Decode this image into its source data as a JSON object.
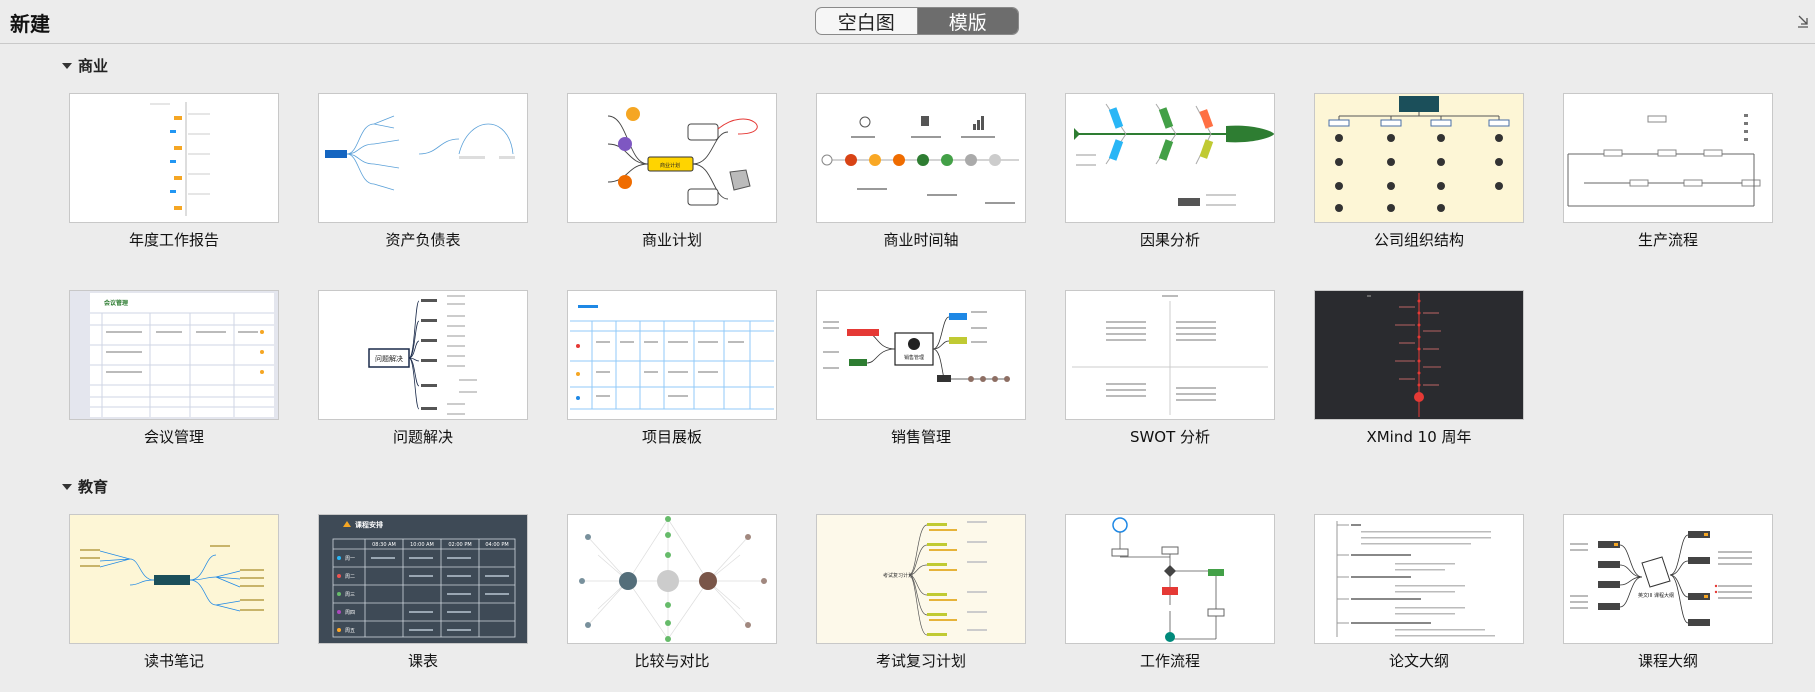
{
  "header": {
    "title": "新建",
    "tabs": [
      {
        "label": "空白图",
        "active": false
      },
      {
        "label": "模版",
        "active": true
      }
    ],
    "corner_icon": "expand-icon"
  },
  "sections": [
    {
      "title": "商业",
      "templates": [
        {
          "label": "年度工作报告"
        },
        {
          "label": "资产负债表"
        },
        {
          "label": "商业计划"
        },
        {
          "label": "商业时间轴"
        },
        {
          "label": "因果分析"
        },
        {
          "label": "公司组织结构"
        },
        {
          "label": "生产流程"
        },
        {
          "label": "会议管理"
        },
        {
          "label": "问题解决"
        },
        {
          "label": "项目展板"
        },
        {
          "label": "销售管理"
        },
        {
          "label": "SWOT 分析"
        },
        {
          "label": "XMind 10 周年"
        }
      ]
    },
    {
      "title": "教育",
      "templates": [
        {
          "label": "读书笔记"
        },
        {
          "label": "课表"
        },
        {
          "label": "比较与对比"
        },
        {
          "label": "考试复习计划"
        },
        {
          "label": "工作流程"
        },
        {
          "label": "论文大纲"
        },
        {
          "label": "课程大纲"
        }
      ]
    }
  ],
  "thumb_text": {
    "sales_center": "销售管理",
    "problem_center": "问题解决",
    "meeting_title": "会议管理",
    "schedule_title": "课程安排",
    "schedule_days": [
      "周一",
      "周二",
      "周三",
      "周四",
      "周五"
    ],
    "schedule_times": [
      "08:30 AM",
      "10:00 AM",
      "02:00 PM",
      "04:00 PM"
    ],
    "business_center": "商业计划",
    "course_center": "英文III 课程大纲",
    "exam_center": "考试复习计划"
  }
}
